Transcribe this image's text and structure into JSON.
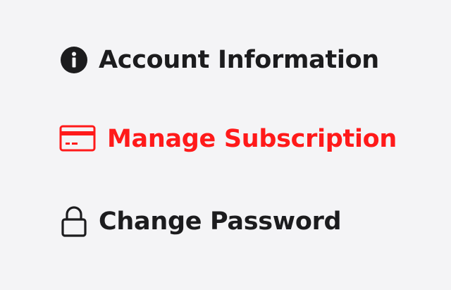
{
  "menu": {
    "items": [
      {
        "label": "Account Information",
        "icon": "info-icon",
        "active": false
      },
      {
        "label": "Manage Subscription",
        "icon": "credit-card-icon",
        "active": true
      },
      {
        "label": "Change Password",
        "icon": "lock-icon",
        "active": false
      }
    ]
  },
  "colors": {
    "background": "#f4f4f6",
    "text": "#1c1c1e",
    "accent": "#ff1a1a"
  }
}
